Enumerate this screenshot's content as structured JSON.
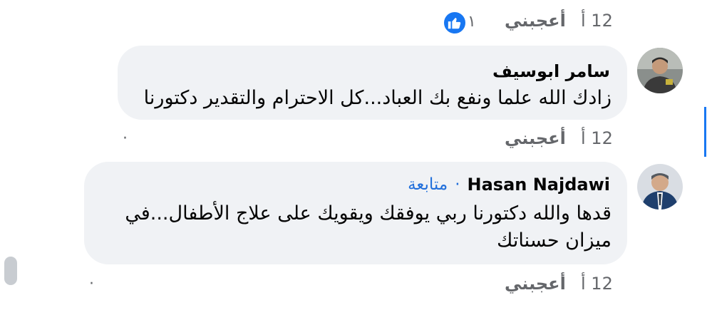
{
  "top_row": {
    "time": "12 أ",
    "like_label": "أعجبني",
    "reaction_count": "١",
    "reaction_icon": "like-thumb-icon"
  },
  "comment1": {
    "author": "سامر ابوسيف",
    "text": "زادك الله علما ونفع بك العباد...كل الاحترام والتقدير دكتورنا",
    "time": "12 أ",
    "like_label": "أعجبني",
    "separator": "·"
  },
  "comment2": {
    "author": "Hasan Najdawi",
    "follow_label": "متابعة",
    "separator_dot": "·",
    "text": "قدها والله دكتورنا ربي يوفقك ويقويك على علاج الأطفال...في ميزان حسناتك",
    "time": "12 أ",
    "like_label": "أعجبني",
    "separator": "·"
  },
  "colors": {
    "bubble": "#f0f2f5",
    "link": "#216fdb",
    "meta": "#65676b",
    "like": "#1877f2"
  }
}
